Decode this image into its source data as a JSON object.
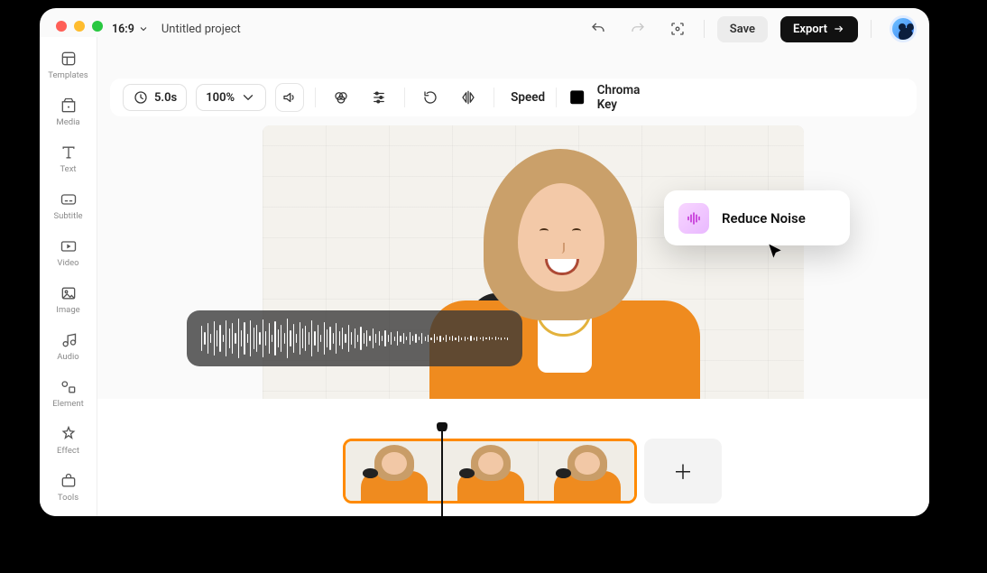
{
  "header": {
    "aspect_ratio": "16:9",
    "project_title": "Untitled project",
    "save_label": "Save",
    "export_label": "Export"
  },
  "sidebar": {
    "items": [
      {
        "label": "Templates"
      },
      {
        "label": "Media"
      },
      {
        "label": "Text"
      },
      {
        "label": "Subtitle"
      },
      {
        "label": "Video"
      },
      {
        "label": "Image"
      },
      {
        "label": "Audio"
      },
      {
        "label": "Element"
      },
      {
        "label": "Effect"
      },
      {
        "label": "Tools"
      }
    ]
  },
  "context_toolbar": {
    "duration": "5.0s",
    "zoom": "100%",
    "speed_label": "Speed",
    "chroma_label": "Chroma Key"
  },
  "popover": {
    "reduce_noise_label": "Reduce Noise"
  },
  "timeline": {
    "add_glyph": "＋"
  }
}
